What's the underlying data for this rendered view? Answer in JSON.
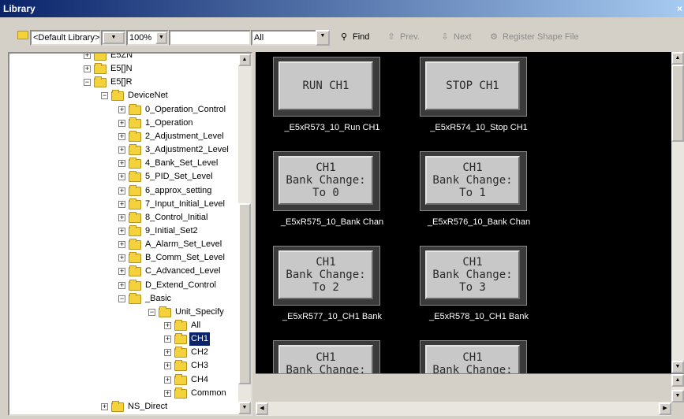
{
  "window": {
    "title": "Library",
    "close": "×"
  },
  "toolbar": {
    "library_select": "<Default Library>",
    "zoom_select": "100%",
    "search_input": "",
    "filter_select": "All",
    "find_label": "Find",
    "prev_label": "Prev.",
    "next_label": "Next",
    "register_label": "Register Shape File"
  },
  "tree": {
    "nodes": [
      {
        "label": "E5ZN"
      },
      {
        "label": "E5[]N"
      },
      {
        "label": "E5[]R"
      },
      {
        "label": "DeviceNet"
      },
      {
        "label": "0_Operation_Control"
      },
      {
        "label": "1_Operation"
      },
      {
        "label": "2_Adjustment_Level"
      },
      {
        "label": "3_Adjustment2_Level"
      },
      {
        "label": "4_Bank_Set_Level"
      },
      {
        "label": "5_PID_Set_Level"
      },
      {
        "label": "6_approx_setting"
      },
      {
        "label": "7_Input_Initial_Level"
      },
      {
        "label": "8_Control_Initial"
      },
      {
        "label": "9_Initial_Set2"
      },
      {
        "label": "A_Alarm_Set_Level"
      },
      {
        "label": "B_Comm_Set_Level"
      },
      {
        "label": "C_Advanced_Level"
      },
      {
        "label": "D_Extend_Control"
      },
      {
        "label": "_Basic"
      },
      {
        "label": "Unit_Specify"
      },
      {
        "label": "All"
      },
      {
        "label": "CH1"
      },
      {
        "label": "CH2"
      },
      {
        "label": "CH3"
      },
      {
        "label": "CH4"
      },
      {
        "label": "Common"
      },
      {
        "label": "NS_Direct"
      }
    ]
  },
  "shapes": [
    {
      "button": "RUN CH1",
      "caption": "_E5xR573_10_Run CH1"
    },
    {
      "button": "STOP CH1",
      "caption": "_E5xR574_10_Stop CH1"
    },
    {
      "button": "CH1\nBank Change:\nTo 0",
      "caption": "_E5xR575_10_Bank Chan"
    },
    {
      "button": "CH1\nBank Change:\nTo 1",
      "caption": "_E5xR576_10_Bank Chan"
    },
    {
      "button": "CH1\nBank Change:\nTo 2",
      "caption": "_E5xR577_10_CH1 Bank"
    },
    {
      "button": "CH1\nBank Change:\nTo 3",
      "caption": "_E5xR578_10_CH1 Bank"
    },
    {
      "button": "CH1\nBank Change:",
      "caption": ""
    },
    {
      "button": "CH1\nBank Change:",
      "caption": ""
    }
  ]
}
